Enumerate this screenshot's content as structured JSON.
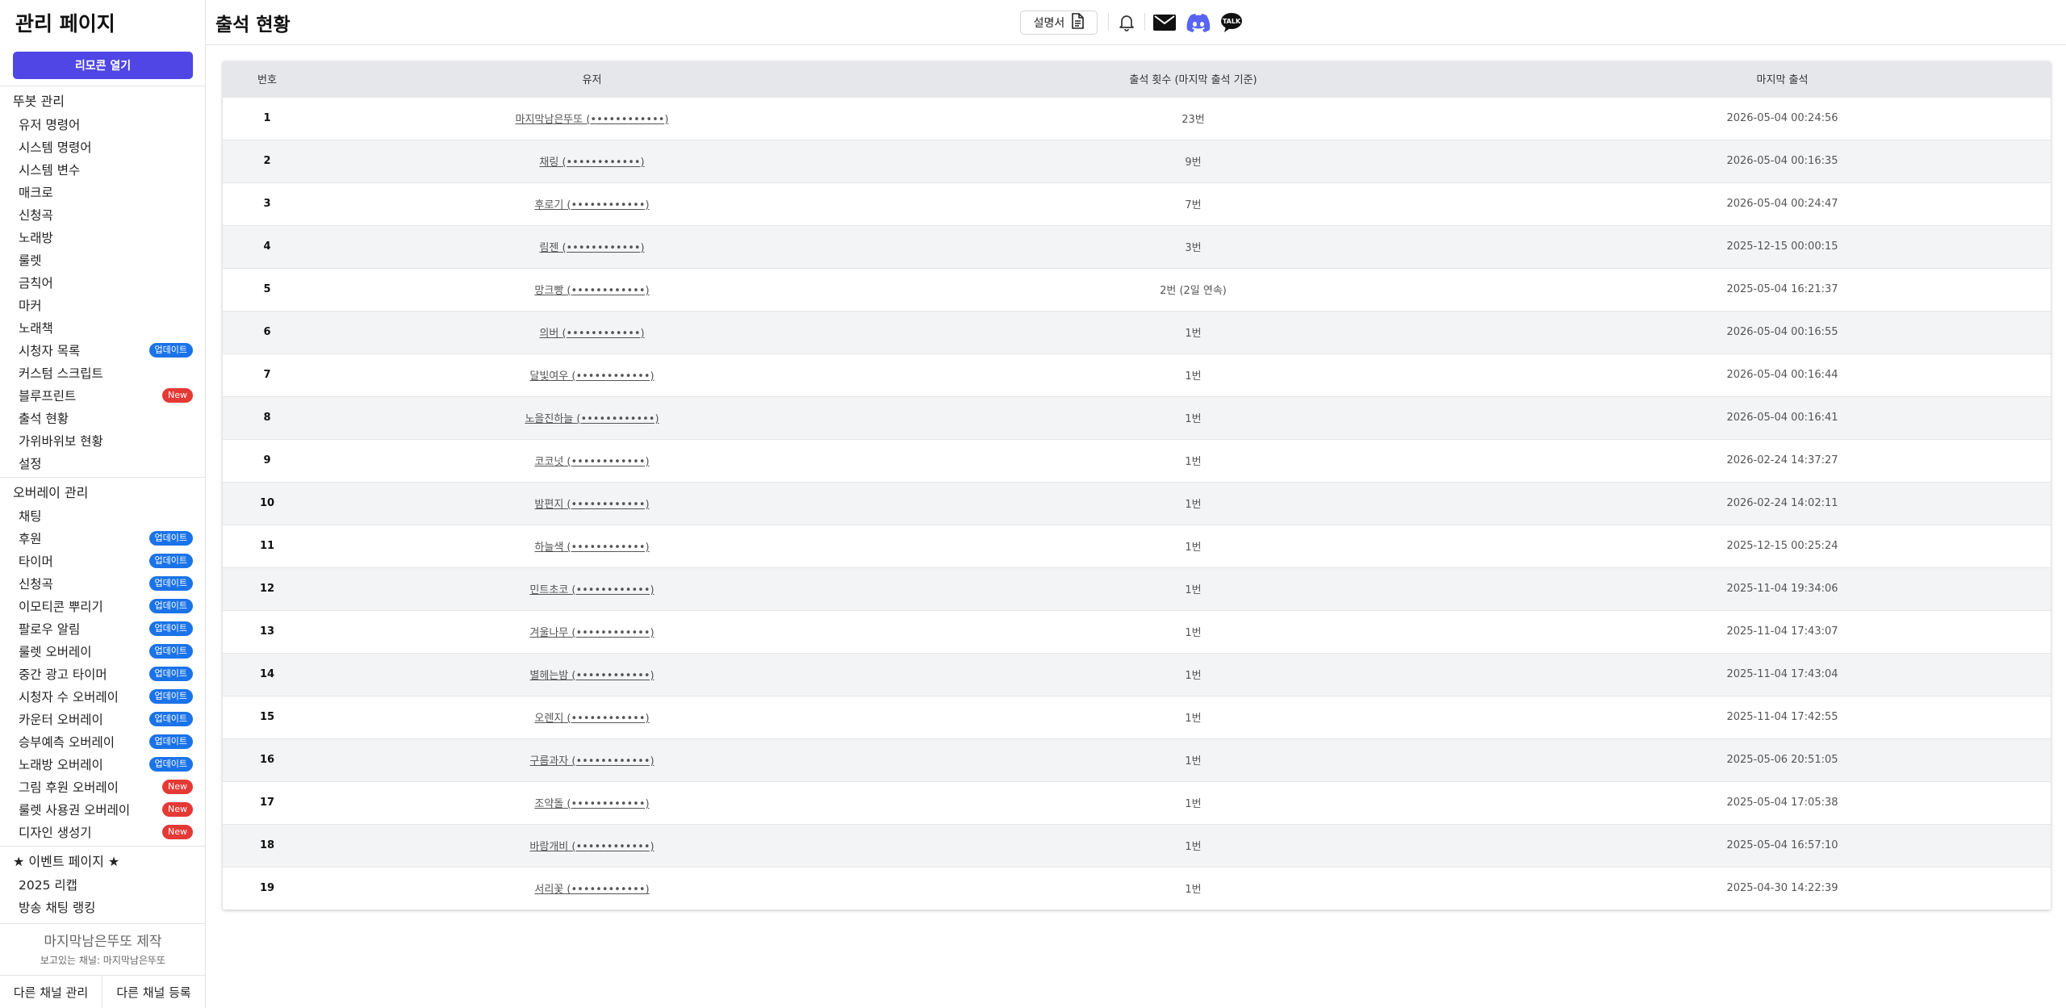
{
  "sidebar": {
    "logo": "관리 페이지",
    "remote_button": "리모콘 열기",
    "section_bot": "뚜봇 관리",
    "bot_items": [
      {
        "label": "유저 명령어",
        "badge": ""
      },
      {
        "label": "시스템 명령어",
        "badge": ""
      },
      {
        "label": "시스템 변수",
        "badge": ""
      },
      {
        "label": "매크로",
        "badge": ""
      },
      {
        "label": "신청곡",
        "badge": ""
      },
      {
        "label": "노래방",
        "badge": ""
      },
      {
        "label": "룰렛",
        "badge": ""
      },
      {
        "label": "금칙어",
        "badge": ""
      },
      {
        "label": "마커",
        "badge": ""
      },
      {
        "label": "노래책",
        "badge": ""
      },
      {
        "label": "시청자 목록",
        "badge": "업데이트"
      },
      {
        "label": "커스텀 스크립트",
        "badge": ""
      },
      {
        "label": "블루프린트",
        "badge": "New"
      },
      {
        "label": "출석 현황",
        "badge": ""
      },
      {
        "label": "가위바위보 현황",
        "badge": ""
      },
      {
        "label": "설정",
        "badge": ""
      }
    ],
    "section_overlay": "오버레이 관리",
    "overlay_items": [
      {
        "label": "채팅",
        "badge": ""
      },
      {
        "label": "후원",
        "badge": "업데이트"
      },
      {
        "label": "타이머",
        "badge": "업데이트"
      },
      {
        "label": "신청곡",
        "badge": "업데이트"
      },
      {
        "label": "이모티콘 뿌리기",
        "badge": "업데이트"
      },
      {
        "label": "팔로우 알림",
        "badge": "업데이트"
      },
      {
        "label": "룰렛 오버레이",
        "badge": "업데이트"
      },
      {
        "label": "중간 광고 타이머",
        "badge": "업데이트"
      },
      {
        "label": "시청자 수 오버레이",
        "badge": "업데이트"
      },
      {
        "label": "카운터 오버레이",
        "badge": "업데이트"
      },
      {
        "label": "승부예측 오버레이",
        "badge": "업데이트"
      },
      {
        "label": "노래방 오버레이",
        "badge": "업데이트"
      },
      {
        "label": "그림 후원 오버레이",
        "badge": "New"
      },
      {
        "label": "룰렛 사용권 오버레이",
        "badge": "New"
      },
      {
        "label": "디자인 생성기",
        "badge": "New"
      }
    ],
    "section_event": "★ 이벤트 페이지 ★",
    "event_items": [
      {
        "label": "2025 리캡",
        "badge": ""
      },
      {
        "label": "방송 채팅 랭킹",
        "badge": ""
      }
    ],
    "credit": "마지막남은뚜또 제작",
    "viewing_channel": "보고있는 채널: 마지막남은뚜또",
    "manage_other": "다른 채널 관리",
    "register_other": "다른 채널 등록"
  },
  "header": {
    "title": "출석 현황",
    "manual_button": "설명서"
  },
  "colors": {
    "accent": "#4f46e5",
    "badge_update": "#1a73e8",
    "badge_new": "#e53935",
    "discord": "#5865f2"
  },
  "table": {
    "headers": [
      "번호",
      "유저",
      "출석 횟수 (마지막 출석 기준)",
      "마지막 출석"
    ],
    "rows": [
      [
        "1",
        "마지막남은뚜또 (••••••••••••)",
        "23번",
        "2026-05-04 00:24:56"
      ],
      [
        "2",
        "채링 (••••••••••••)",
        "9번",
        "2026-05-04 00:16:35"
      ],
      [
        "3",
        "후로기 (••••••••••••)",
        "7번",
        "2026-05-04 00:24:47"
      ],
      [
        "4",
        "림젠 (••••••••••••)",
        "3번",
        "2025-12-15 00:00:15"
      ],
      [
        "5",
        "망크빵 (••••••••••••)",
        "2번 (2일 연속)",
        "2025-05-04 16:21:37"
      ],
      [
        "6",
        "의버 (••••••••••••)",
        "1번",
        "2026-05-04 00:16:55"
      ],
      [
        "7",
        "달빛여우 (••••••••••••)",
        "1번",
        "2026-05-04 00:16:44"
      ],
      [
        "8",
        "노을진하늘 (••••••••••••)",
        "1번",
        "2026-05-04 00:16:41"
      ],
      [
        "9",
        "코코넛 (••••••••••••)",
        "1번",
        "2026-02-24 14:37:27"
      ],
      [
        "10",
        "밤편지 (••••••••••••)",
        "1번",
        "2026-02-24 14:02:11"
      ],
      [
        "11",
        "하늘색 (••••••••••••)",
        "1번",
        "2025-12-15 00:25:24"
      ],
      [
        "12",
        "민트초코 (••••••••••••)",
        "1번",
        "2025-11-04 19:34:06"
      ],
      [
        "13",
        "겨울나무 (••••••••••••)",
        "1번",
        "2025-11-04 17:43:07"
      ],
      [
        "14",
        "별헤는밤 (••••••••••••)",
        "1번",
        "2025-11-04 17:43:04"
      ],
      [
        "15",
        "오렌지 (••••••••••••)",
        "1번",
        "2025-11-04 17:42:55"
      ],
      [
        "16",
        "구름과자 (••••••••••••)",
        "1번",
        "2025-05-06 20:51:05"
      ],
      [
        "17",
        "조약돌 (••••••••••••)",
        "1번",
        "2025-05-04 17:05:38"
      ],
      [
        "18",
        "바람개비 (••••••••••••)",
        "1번",
        "2025-05-04 16:57:10"
      ],
      [
        "19",
        "서리꽃 (••••••••••••)",
        "1번",
        "2025-04-30 14:22:39"
      ]
    ]
  }
}
